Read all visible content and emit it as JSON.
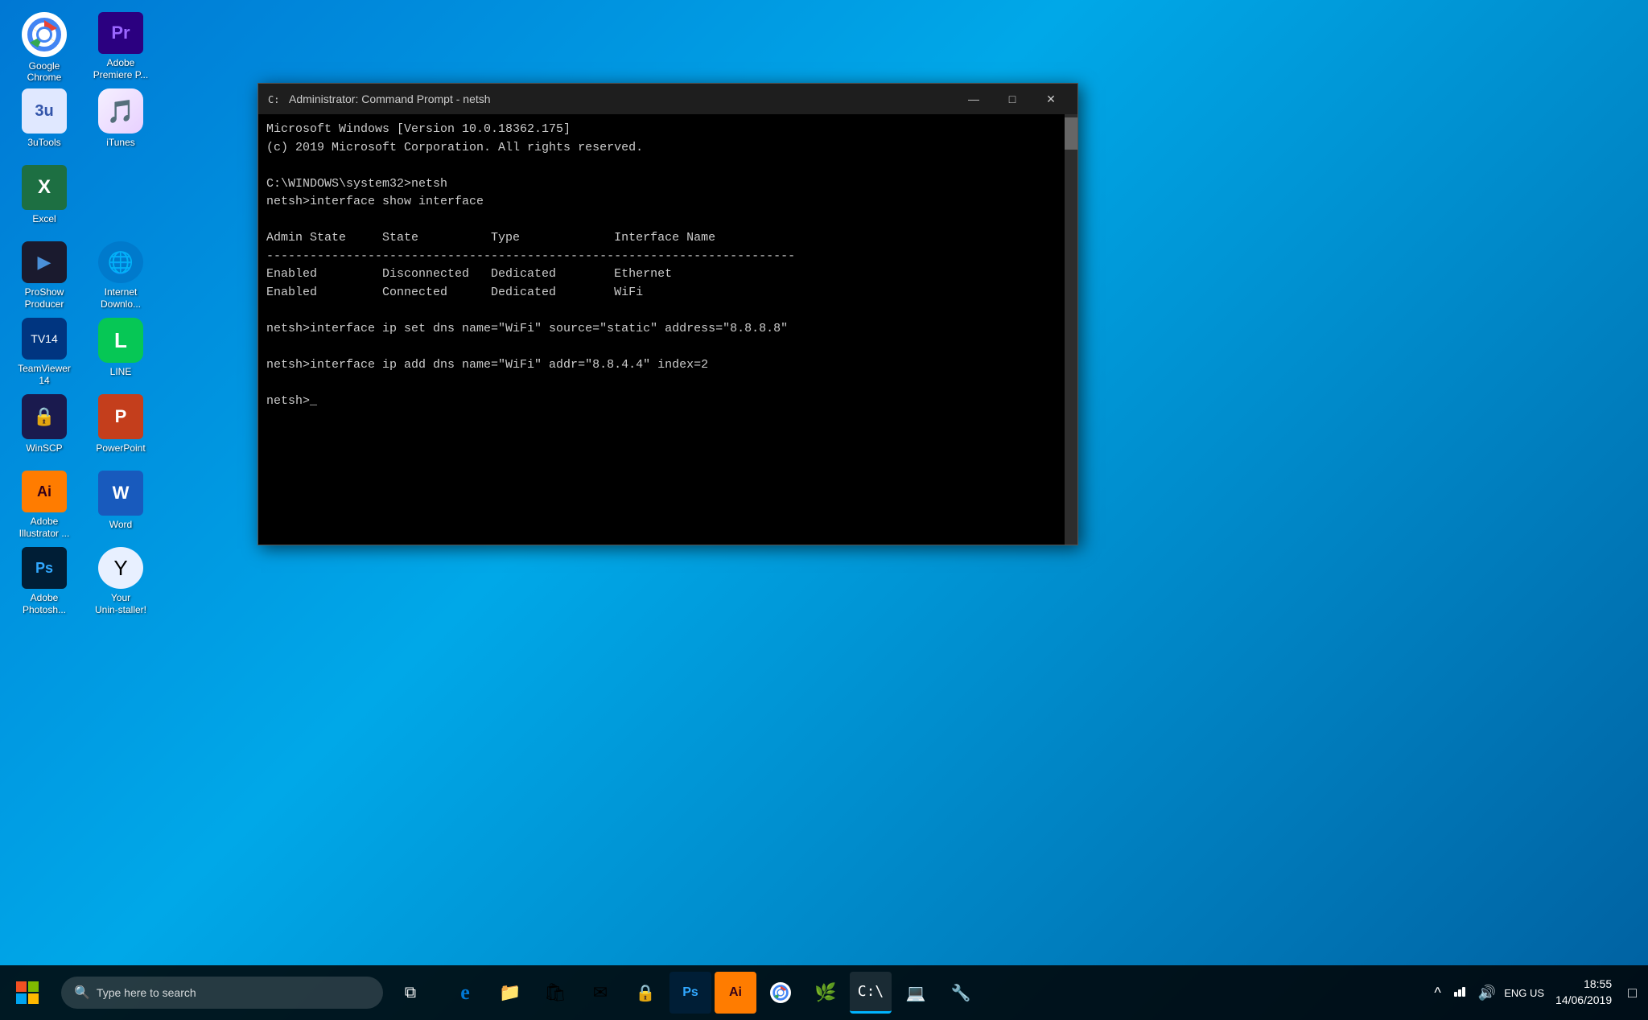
{
  "desktop": {
    "background": "blue-gradient"
  },
  "desktop_icons": [
    {
      "id": "google-chrome",
      "label": "Google Chrome",
      "icon_type": "chrome"
    },
    {
      "id": "adobe-premiere",
      "label": "Adobe\nPremiere P...",
      "icon_type": "premiere"
    },
    {
      "id": "3utools",
      "label": "3uTools",
      "icon_type": "3utools"
    },
    {
      "id": "itunes",
      "label": "iTunes",
      "icon_type": "itunes"
    },
    {
      "id": "excel",
      "label": "Excel",
      "icon_type": "excel"
    },
    {
      "id": "proshow-producer",
      "label": "ProShow\nProducer",
      "icon_type": "proshow"
    },
    {
      "id": "internet-download",
      "label": "Internet\nDownlo...",
      "icon_type": "idm"
    },
    {
      "id": "teamviewer",
      "label": "TeamViewer\n14",
      "icon_type": "teamviewer"
    },
    {
      "id": "line",
      "label": "LINE",
      "icon_type": "line"
    },
    {
      "id": "winscp",
      "label": "WinSCP",
      "icon_type": "winscp"
    },
    {
      "id": "powerpoint",
      "label": "PowerPoint",
      "icon_type": "powerpoint"
    },
    {
      "id": "adobe-illustrator",
      "label": "Adobe\nIllustrator ...",
      "icon_type": "illustrator"
    },
    {
      "id": "word",
      "label": "Word",
      "icon_type": "word"
    },
    {
      "id": "adobe-photoshop",
      "label": "Adobe\nPhotosh...",
      "icon_type": "photoshop"
    },
    {
      "id": "uninstaller",
      "label": "Your\nUnin-staller!",
      "icon_type": "uninstaller"
    }
  ],
  "cmd_window": {
    "title": "Administrator: Command Prompt - netsh",
    "content_lines": [
      "Microsoft Windows [Version 10.0.18362.175]",
      "(c) 2019 Microsoft Corporation. All rights reserved.",
      "",
      "C:\\WINDOWS\\system32>netsh",
      "netsh>interface show interface",
      "",
      "Admin State     State          Type             Interface Name",
      "-------------------------------------------------------------------------",
      "Enabled         Disconnected   Dedicated        Ethernet",
      "Enabled         Connected      Dedicated        WiFi",
      "",
      "netsh>interface ip set dns name=\"WiFi\" source=\"static\" address=\"8.8.8.8\"",
      "",
      "netsh>interface ip add dns name=\"WiFi\" addr=\"8.8.4.4\" index=2",
      "",
      "netsh>_"
    ]
  },
  "taskbar": {
    "search_placeholder": "Type here to search",
    "search_icon": "🔍",
    "time": "18:55",
    "date": "14/06/2019",
    "language": "ENG\nUS"
  },
  "taskbar_icons": [
    {
      "id": "task-view",
      "label": "Task View",
      "symbol": "⧉"
    },
    {
      "id": "edge",
      "label": "Microsoft Edge",
      "symbol": "e",
      "color": "#0078d4"
    },
    {
      "id": "file-explorer",
      "label": "File Explorer",
      "symbol": "📁"
    },
    {
      "id": "microsoft-store",
      "label": "Microsoft Store",
      "symbol": "🛍"
    },
    {
      "id": "mail",
      "label": "Mail",
      "symbol": "✉"
    },
    {
      "id": "vpn",
      "label": "VPN",
      "symbol": "🔒"
    },
    {
      "id": "photoshop-tb",
      "label": "Photoshop",
      "symbol": "Ps"
    },
    {
      "id": "illustrator-tb",
      "label": "Illustrator",
      "symbol": "Ai"
    },
    {
      "id": "chrome-tb",
      "label": "Google Chrome",
      "symbol": "⬤"
    },
    {
      "id": "green-app",
      "label": "App",
      "symbol": "🌿"
    },
    {
      "id": "cmd-tb",
      "label": "Command Prompt",
      "symbol": "▮",
      "active": true
    },
    {
      "id": "remote",
      "label": "Remote",
      "symbol": "💻"
    },
    {
      "id": "tools",
      "label": "Tools",
      "symbol": "🔧"
    }
  ]
}
